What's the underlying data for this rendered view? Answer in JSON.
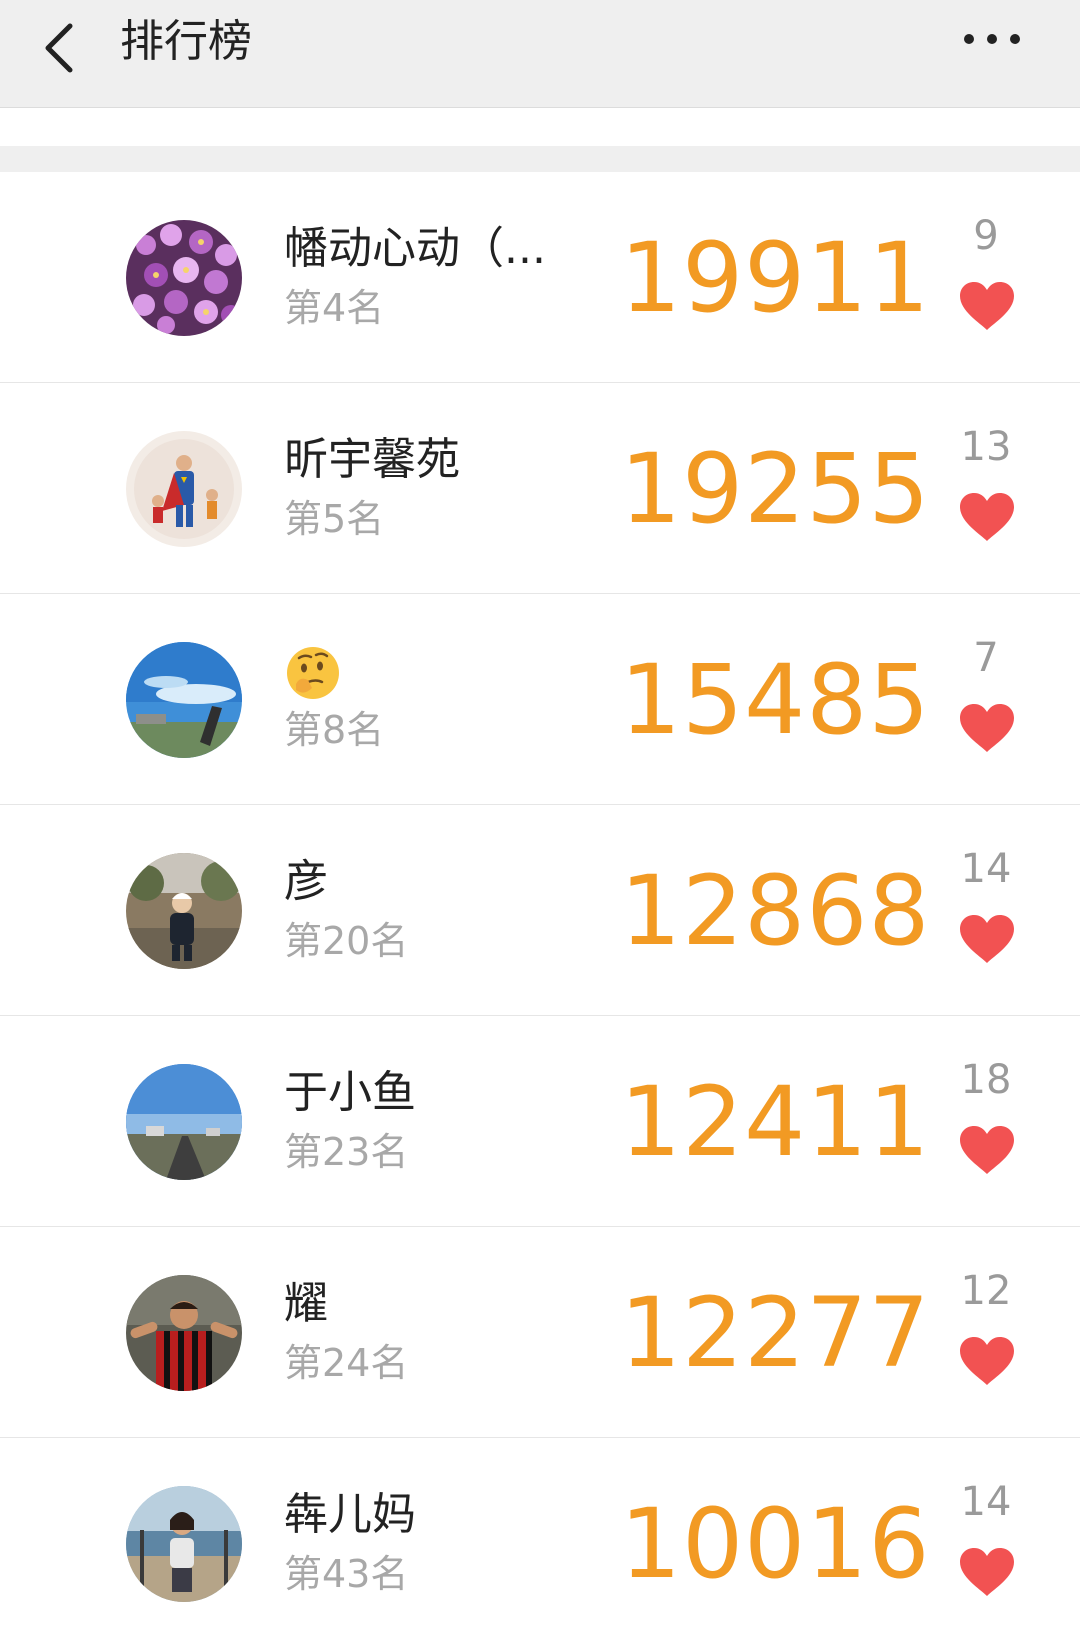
{
  "header": {
    "title": "排行榜",
    "back_icon": "back-chevron-icon",
    "more_icon": "more-dots-icon"
  },
  "colors": {
    "steps": "#f29a23",
    "heart": "#f25252",
    "rank": "#a8a8a8",
    "header_bg": "#efefef"
  },
  "rows": [
    {
      "name": "幡动心动（...",
      "rank": "第4名",
      "steps": "19911",
      "likes": "9",
      "avatar": "purple-flowers-avatar"
    },
    {
      "name": "昕宇馨苑",
      "rank": "第5名",
      "steps": "19255",
      "likes": "13",
      "avatar": "superman-family-avatar"
    },
    {
      "name": "",
      "rank": "第8名",
      "steps": "15485",
      "likes": "7",
      "avatar": "blue-sky-avatar",
      "name_icon": "thinking-face-emoji"
    },
    {
      "name": "彦",
      "rank": "第20名",
      "steps": "12868",
      "likes": "14",
      "avatar": "child-park-avatar"
    },
    {
      "name": "于小鱼",
      "rank": "第23名",
      "steps": "12411",
      "likes": "18",
      "avatar": "sky-road-avatar"
    },
    {
      "name": "耀",
      "rank": "第24名",
      "steps": "12277",
      "likes": "12",
      "avatar": "football-player-avatar"
    },
    {
      "name": "犇儿妈",
      "rank": "第43名",
      "steps": "10016",
      "likes": "14",
      "avatar": "beach-woman-avatar"
    }
  ]
}
